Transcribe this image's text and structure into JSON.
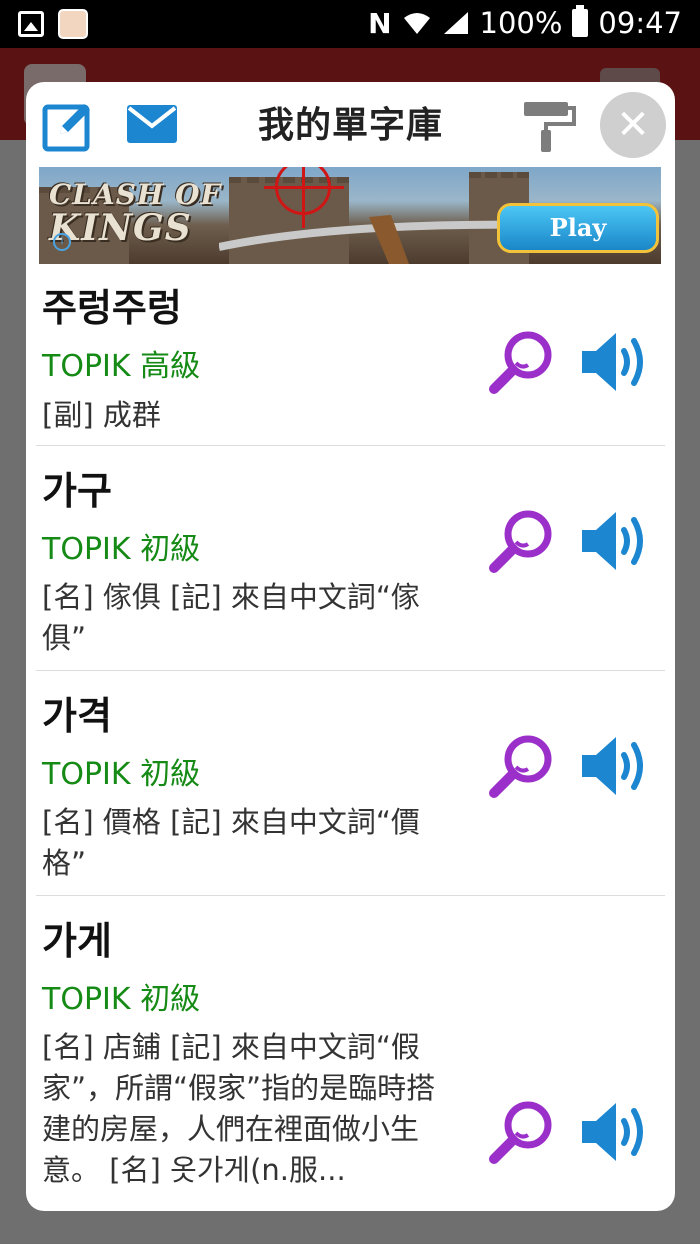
{
  "status_bar": {
    "battery": "100%",
    "time": "09:47",
    "network_letter": "N"
  },
  "dialog": {
    "title": "我的單字庫"
  },
  "ad": {
    "game_name_line1": "CLASH OF",
    "game_name_line2": "KINGS",
    "play_label": "Play",
    "info_glyph": "i"
  },
  "words": [
    {
      "word": "주렁주렁",
      "level": "TOPIK 高級",
      "definition": "[副] 成群"
    },
    {
      "word": "가구",
      "level": "TOPIK 初級",
      "definition": "[名] 傢俱 [記] 來自中文詞“傢俱”"
    },
    {
      "word": "가격",
      "level": "TOPIK 初級",
      "definition": "[名] 價格 [記] 來自中文詞“價格”"
    },
    {
      "word": "가게",
      "level": "TOPIK 初級",
      "definition": "[名] 店鋪 [記] 來自中文詞“假家”，所謂“假家”指的是臨時搭建的房屋，人們在裡面做小生意。 [名] 옷가게(n.服..."
    }
  ],
  "colors": {
    "accent_blue": "#1c86d1",
    "lookup_purple": "#9b2fc9",
    "level_green": "#158a15",
    "close_grey": "#cfcfcf"
  },
  "icons": {
    "edit": "edit-icon",
    "mail": "mail-icon",
    "theme": "paint-roller-icon",
    "close": "close-icon",
    "lookup": "magnifier-icon",
    "sound": "speaker-icon"
  }
}
